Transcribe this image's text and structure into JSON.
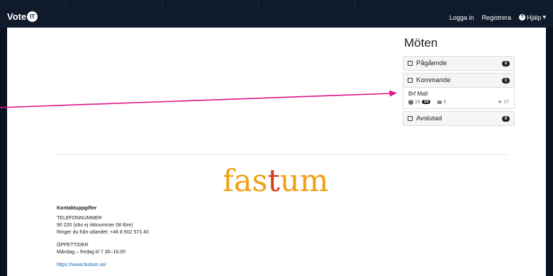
{
  "nav": {
    "logo_text": "Vote",
    "logo_badge": "IT",
    "login": "Logga in",
    "register": "Registrera",
    "help": "Hjälp"
  },
  "meetings": {
    "title": "Möten",
    "ongoing": {
      "label": "Pågående",
      "count": "0"
    },
    "upcoming": {
      "label": "Kommande",
      "count": "1"
    },
    "concluded": {
      "label": "Avslutad",
      "count": "0"
    },
    "item": {
      "name": "Brf Mall",
      "speakers": "16",
      "speakers_badge": "16",
      "comments": "0",
      "stars": "17"
    }
  },
  "footer": {
    "brand": "fastum",
    "contact_heading": "Kontaktuppgifter",
    "phone_heading": "TELEFONNUMMER",
    "phone_line1": "90 220 (obs ej riktnummer 08 före)",
    "phone_line2": "Ringer du från utlandet: +46 8 502 573 40",
    "hours_heading": "ÖPPETTIDER",
    "hours_line": "Måndag – fredag kl 7.30–16.00",
    "website": "https://www.fastum.se/"
  },
  "colors": {
    "annotation_arrow": "#e0138a",
    "brand_orange": "#f0a014",
    "brand_red": "#d63a1a"
  }
}
